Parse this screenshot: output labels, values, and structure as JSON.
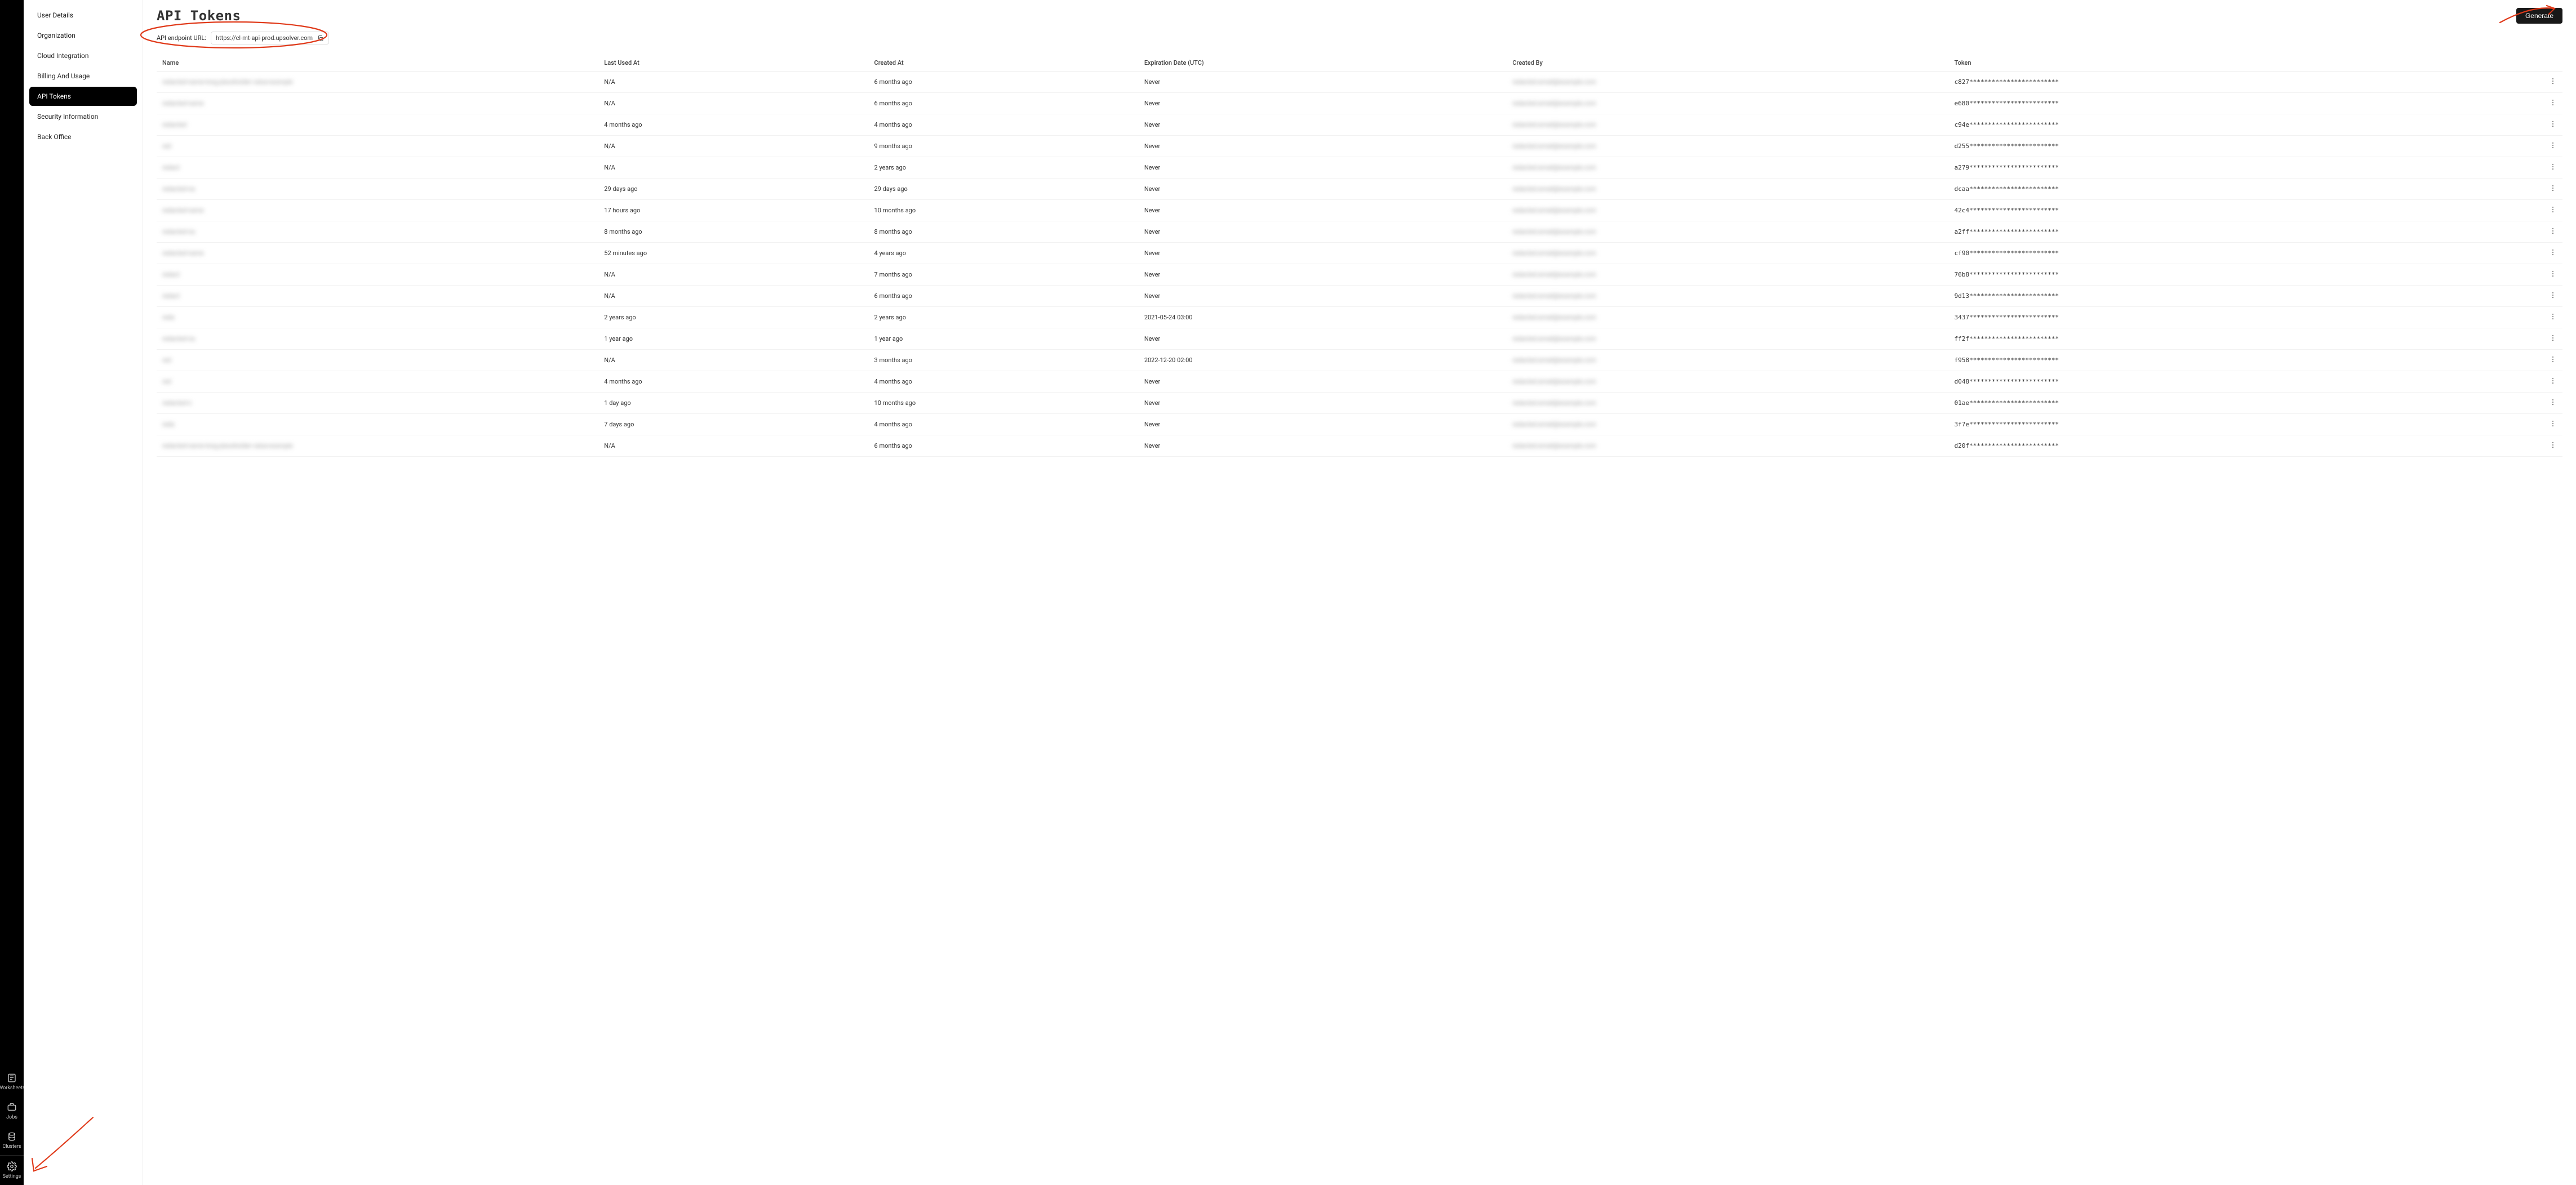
{
  "rail": {
    "worksheets": "Worksheets",
    "jobs": "Jobs",
    "clusters": "Clusters",
    "settings": "Settings"
  },
  "menu": {
    "items": [
      {
        "label": "User Details",
        "active": false
      },
      {
        "label": "Organization",
        "active": false
      },
      {
        "label": "Cloud Integration",
        "active": false
      },
      {
        "label": "Billing And Usage",
        "active": false
      },
      {
        "label": "API Tokens",
        "active": true
      },
      {
        "label": "Security Information",
        "active": false
      },
      {
        "label": "Back Office",
        "active": false
      }
    ]
  },
  "header": {
    "title": "API Tokens",
    "generate": "Generate"
  },
  "endpoint": {
    "label": "API endpoint URL:",
    "value": "https://cl-mt-api-prod.upsolver.com"
  },
  "table": {
    "columns": {
      "name": "Name",
      "last_used": "Last Used At",
      "created": "Created At",
      "expiration": "Expiration Date (UTC)",
      "created_by": "Created By",
      "token": "Token"
    },
    "rows": [
      {
        "name": "redacted-name-long-placeholder-value-example",
        "last_used": "N/A",
        "created": "6 months ago",
        "expiration": "Never",
        "created_by": "redacted.email@example.com",
        "token": "c827************************"
      },
      {
        "name": "redacted-name",
        "last_used": "N/A",
        "created": "6 months ago",
        "expiration": "Never",
        "created_by": "redacted.email@example.com",
        "token": "e680************************"
      },
      {
        "name": "redacted",
        "last_used": "4 months ago",
        "created": "4 months ago",
        "expiration": "Never",
        "created_by": "redacted.email@example.com",
        "token": "c94e************************"
      },
      {
        "name": "red",
        "last_used": "N/A",
        "created": "9 months ago",
        "expiration": "Never",
        "created_by": "redacted.email@example.com",
        "token": "d255************************"
      },
      {
        "name": "redact",
        "last_used": "N/A",
        "created": "2 years ago",
        "expiration": "Never",
        "created_by": "redacted.email@example.com",
        "token": "a279************************"
      },
      {
        "name": "redacted-na",
        "last_used": "29 days ago",
        "created": "29 days ago",
        "expiration": "Never",
        "created_by": "redacted.email@example.com",
        "token": "dcaa************************"
      },
      {
        "name": "redacted-name",
        "last_used": "17 hours ago",
        "created": "10 months ago",
        "expiration": "Never",
        "created_by": "redacted.email@example.com",
        "token": "42c4************************"
      },
      {
        "name": "redacted-na",
        "last_used": "8 months ago",
        "created": "8 months ago",
        "expiration": "Never",
        "created_by": "redacted.email@example.com",
        "token": "a2ff************************"
      },
      {
        "name": "redacted-name",
        "last_used": "52 minutes ago",
        "created": "4 years ago",
        "expiration": "Never",
        "created_by": "redacted.email@example.com",
        "token": "cf90************************"
      },
      {
        "name": "redact",
        "last_used": "N/A",
        "created": "7 months ago",
        "expiration": "Never",
        "created_by": "redacted.email@example.com",
        "token": "76b8************************"
      },
      {
        "name": "redact",
        "last_used": "N/A",
        "created": "6 months ago",
        "expiration": "Never",
        "created_by": "redacted.email@example.com",
        "token": "9d13************************"
      },
      {
        "name": "reda",
        "last_used": "2 years ago",
        "created": "2 years ago",
        "expiration": "2021-05-24 03:00",
        "created_by": "redacted.email@example.com",
        "token": "3437************************"
      },
      {
        "name": "redacted-na",
        "last_used": "1 year ago",
        "created": "1 year ago",
        "expiration": "Never",
        "created_by": "redacted.email@example.com",
        "token": "ff2f************************"
      },
      {
        "name": "red",
        "last_used": "N/A",
        "created": "3 months ago",
        "expiration": "2022-12-20 02:00",
        "created_by": "redacted.email@example.com",
        "token": "f958************************"
      },
      {
        "name": "red",
        "last_used": "4 months ago",
        "created": "4 months ago",
        "expiration": "Never",
        "created_by": "redacted.email@example.com",
        "token": "d048************************"
      },
      {
        "name": "redacted-n",
        "last_used": "1 day ago",
        "created": "10 months ago",
        "expiration": "Never",
        "created_by": "redacted.email@example.com",
        "token": "01ae************************"
      },
      {
        "name": "reda",
        "last_used": "7 days ago",
        "created": "4 months ago",
        "expiration": "Never",
        "created_by": "redacted.email@example.com",
        "token": "3f7e************************"
      },
      {
        "name": "redacted-name-long-placeholder-value-example",
        "last_used": "N/A",
        "created": "6 months ago",
        "expiration": "Never",
        "created_by": "redacted.email@example.com",
        "token": "d20f************************"
      }
    ]
  }
}
